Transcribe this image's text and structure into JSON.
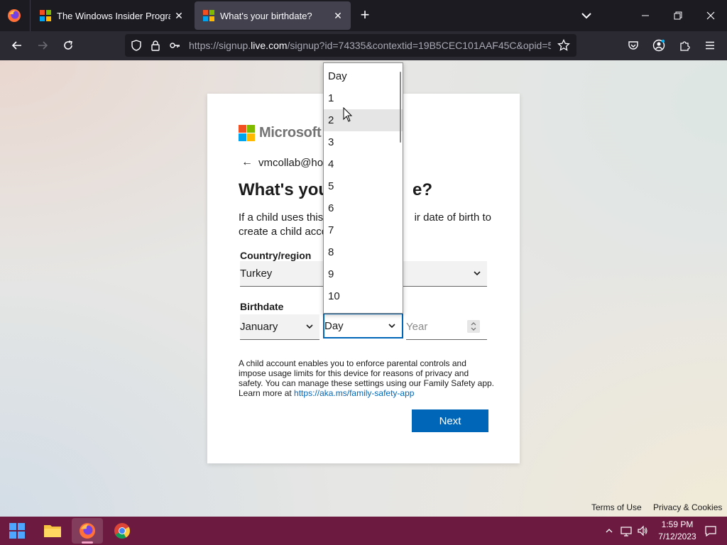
{
  "browser": {
    "tabs": [
      {
        "title": "The Windows Insider Program",
        "active": false
      },
      {
        "title": "What's your birthdate?",
        "active": true
      }
    ],
    "url_prefix": "https://signup.",
    "url_domain": "live.com",
    "url_rest": "/signup?id=74335&contextid=19B5CEC101AAF45C&opid=5"
  },
  "page": {
    "brand": "Microsoft",
    "identity": "vmcollab@ho",
    "heading_start": "What's you",
    "heading_end": "e?",
    "desc_start": "If a child uses this",
    "desc_right": "ir date of birth to",
    "desc_line2": "create a child acco",
    "country_label": "Country/region",
    "country_value": "Turkey",
    "birthdate_label": "Birthdate",
    "month_value": "January",
    "day_value": "Day",
    "year_placeholder": "Year",
    "note_text": "A child account enables you to enforce parental controls and impose usage limits for this device for reasons of privacy and safety. You can manage these settings using our Family Safety app. Learn more at ",
    "note_link": "https://aka.ms/family-safety-app",
    "next_label": "Next",
    "terms_label": "Terms of Use",
    "privacy_label": "Privacy & Cookies"
  },
  "day_dropdown": {
    "options": [
      "Day",
      "1",
      "2",
      "3",
      "4",
      "5",
      "6",
      "7",
      "8",
      "9",
      "10"
    ],
    "hovered": "2"
  },
  "taskbar": {
    "time": "1:59 PM",
    "date": "7/12/2023"
  },
  "colors": {
    "accent": "#0067b8",
    "taskbar": "#6d1a40"
  }
}
